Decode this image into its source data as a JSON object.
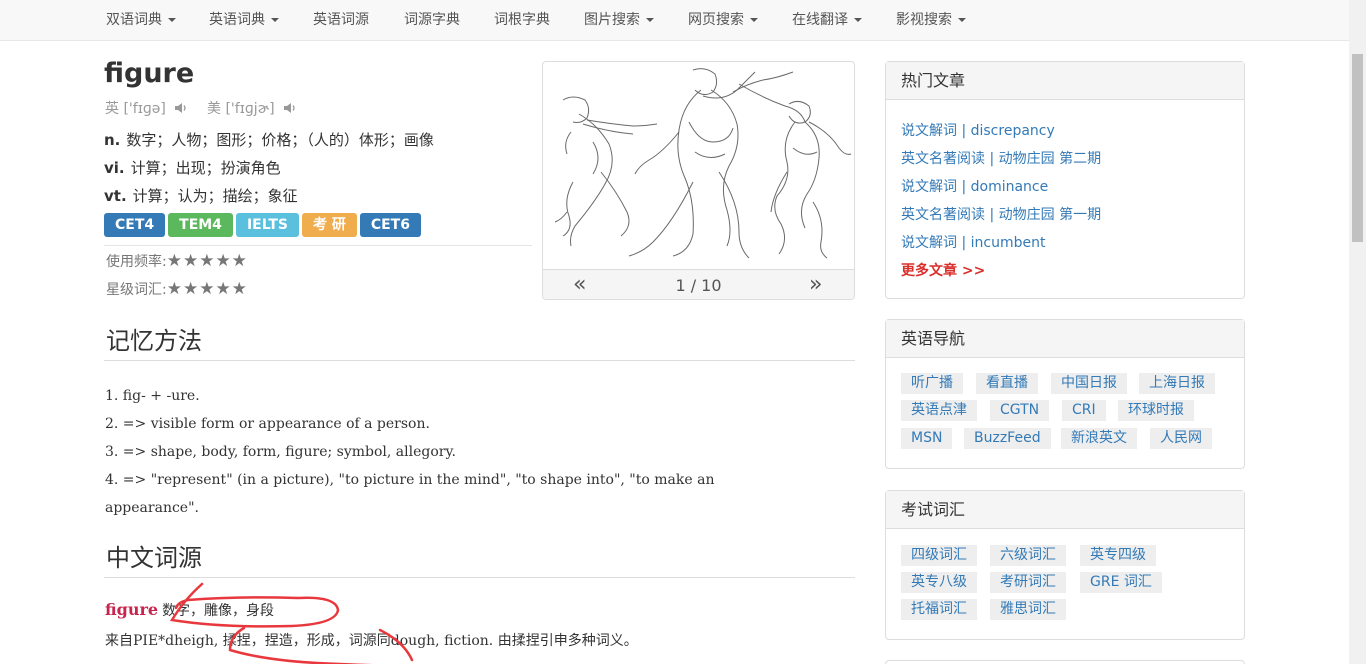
{
  "nav": {
    "items": [
      {
        "label": "双语词典",
        "dropdown": true
      },
      {
        "label": "英语词典",
        "dropdown": true
      },
      {
        "label": "英语词源",
        "dropdown": false
      },
      {
        "label": "词源字典",
        "dropdown": false
      },
      {
        "label": "词根字典",
        "dropdown": false
      },
      {
        "label": "图片搜索",
        "dropdown": true
      },
      {
        "label": "网页搜索",
        "dropdown": true
      },
      {
        "label": "在线翻译",
        "dropdown": true
      },
      {
        "label": "影视搜索",
        "dropdown": true
      }
    ]
  },
  "word": {
    "headword": "figure",
    "pron_uk": "英 ['fɪɡə]",
    "pron_us": "美 ['fɪɡjɚ]",
    "definitions": [
      {
        "pos": "n.",
        "text": "数字；人物；图形；价格；（人的）体形；画像"
      },
      {
        "pos": "vi.",
        "text": "计算；出现；扮演角色"
      },
      {
        "pos": "vt.",
        "text": "计算；认为；描绘；象征"
      }
    ],
    "badges": [
      {
        "label": "CET4",
        "color": "#337ab7"
      },
      {
        "label": "TEM4",
        "color": "#5cb85c"
      },
      {
        "label": "IELTS",
        "color": "#5bc0de"
      },
      {
        "label": "考 研",
        "color": "#f0ad4e"
      },
      {
        "label": "CET6",
        "color": "#337ab7"
      }
    ],
    "freq_label": "使用频率:",
    "freq_stars": "★★★★★",
    "level_label": "星级词汇:",
    "level_stars": "★★★★★"
  },
  "carousel": {
    "counter": "1 / 10",
    "prev": "«",
    "next": "»"
  },
  "memory": {
    "heading": "记忆方法",
    "lines": [
      "1. fig- + -ure.",
      "2. => visible form or appearance of a person.",
      "3. => shape, body, form, figure; symbol, allegory.",
      "4. => \"represent\" (in a picture), \"to picture in the mind\", \"to shape into\", \"to make an",
      "appearance\"."
    ]
  },
  "etymology": {
    "heading": "中文词源",
    "keyword": "figure",
    "keyword_meaning": "数字，雕像，身段",
    "line2": "来自PIE*dheigh, 揉捏，捏造，形成，词源同dough, fiction. 由揉捏引申多种词义。"
  },
  "sidebar": {
    "hot": {
      "title": "热门文章",
      "articles": [
        "说文解词 | discrepancy",
        "英文名著阅读 | 动物庄园 第二期",
        "说文解词 | dominance",
        "英文名著阅读 | 动物庄园 第一期",
        "说文解词 | incumbent"
      ],
      "more": "更多文章 >>"
    },
    "nav": {
      "title": "英语导航",
      "tags": [
        "听广播",
        "看直播",
        "中国日报",
        "上海日报",
        "英语点津",
        "CGTN",
        "CRI",
        "环球时报",
        "MSN",
        "BuzzFeed",
        "新浪英文",
        "人民网"
      ]
    },
    "exam": {
      "title": "考试词汇",
      "tags": [
        "四级词汇",
        "六级词汇",
        "英专四级",
        "英专八级",
        "考研词汇",
        "GRE 词汇",
        "托福词汇",
        "雅思词汇"
      ]
    }
  }
}
